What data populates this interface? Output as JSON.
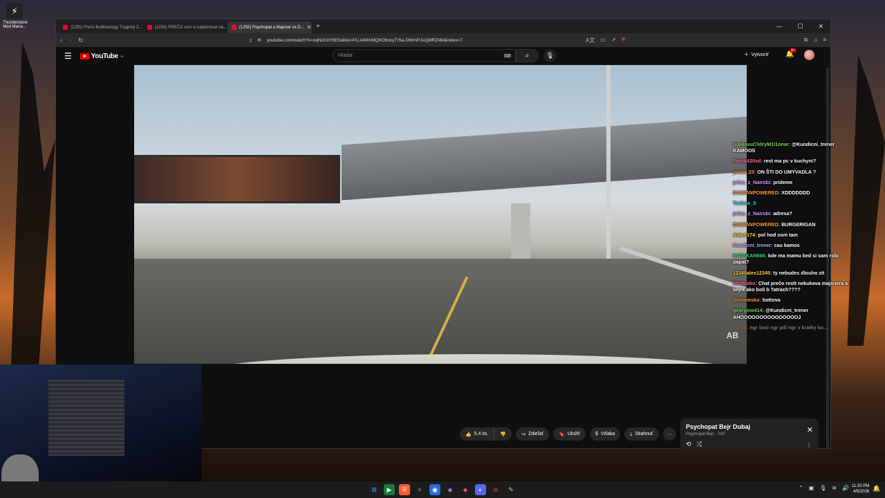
{
  "desktop": {
    "icon_label": "Thunderstore Mod Mana..."
  },
  "browser": {
    "tabs": [
      {
        "title": "(1255) Prečo Bubbleology Tragický Z..."
      },
      {
        "title": "(1255) PREČO som si naplánoval vla..."
      },
      {
        "title": "(1255) Psychopat a Majsner vs D..."
      }
    ],
    "url": "youtube.com/watch?v=oqNx31HSEfo&list=PLUi4WvMQKO6ocyTISa-OWmPJu2jMRZl4k&index=7"
  },
  "youtube": {
    "logo_text": "YouTube",
    "logo_region": "SK",
    "search_placeholder": "Hľadať",
    "create_label": "Vytvoriť",
    "notif_count": "9+",
    "actions": {
      "likes": "5,4 tis.",
      "share": "Zdieľať",
      "save": "Uložiť",
      "thanks": "Vďaka",
      "download": "Stiahnuť"
    },
    "playlist": {
      "title": "Psychopat Bejr  Dubaj",
      "channel": "Psychopat Bejr",
      "position": "7/47"
    }
  },
  "chat": [
    {
      "user": "NaHlavuCh0ryM1l1onar:",
      "text": "@Kundicni_trener KAMOOS",
      "color": "#7ed957"
    },
    {
      "user": "Patrik420xd:",
      "text": "rest ma pc v kuchyni?",
      "color": "#ff6fb0"
    },
    {
      "user": "yonie_23:",
      "text": "ON ŠTI DO UMYVADLA ?",
      "color": "#ff9d3d"
    },
    {
      "user": "princ_z_Nairobi:",
      "text": "prideme",
      "color": "#c9a7ff"
    },
    {
      "user": "DAMIANPOWERED:",
      "text": "XDDDDDDD",
      "color": "#ff9d3d"
    },
    {
      "user": "Techno_3:",
      "text": "",
      "color": "#3ddcff"
    },
    {
      "user": "princ_z_Nairobi:",
      "text": "adresa?",
      "color": "#c9a7ff"
    },
    {
      "user": "DAMIANPOWERED:",
      "text": "BURGERIGAN",
      "color": "#ff9d3d"
    },
    {
      "user": "Adam174:",
      "text": "pol hod som tam",
      "color": "#ffd23d"
    },
    {
      "user": "Kundicni_trener:",
      "text": "cau kamos",
      "color": "#c9a7ff"
    },
    {
      "user": "KATAKAN666:",
      "text": "kde ma mamu ked si sam robi papat?",
      "color": "#3ddc84"
    },
    {
      "user": "12345alex12345:",
      "text": "ty nebudes dlouho zit",
      "color": "#ffd23d"
    },
    {
      "user": "Nebbisko:",
      "text": "Chat prečo restt nekukava majsnera a bejra ako boli b Tatrach????",
      "color": "#ff6fb0"
    },
    {
      "user": "Simonesko:",
      "text": "bottova",
      "color": "#ff9d3d"
    },
    {
      "user": "georgino414:",
      "text": "@Kundicni_trener AHOOOOOOOOOOOOOOOJ",
      "color": "#7ed957"
    },
    {
      "user": "...._75:",
      "text": "ngr bezi ngr pili ngr v kratky ko...",
      "color": "#ff9d3d"
    }
  ],
  "taskbar": {
    "time": "11:20 PM",
    "date": "4/5/2026"
  }
}
